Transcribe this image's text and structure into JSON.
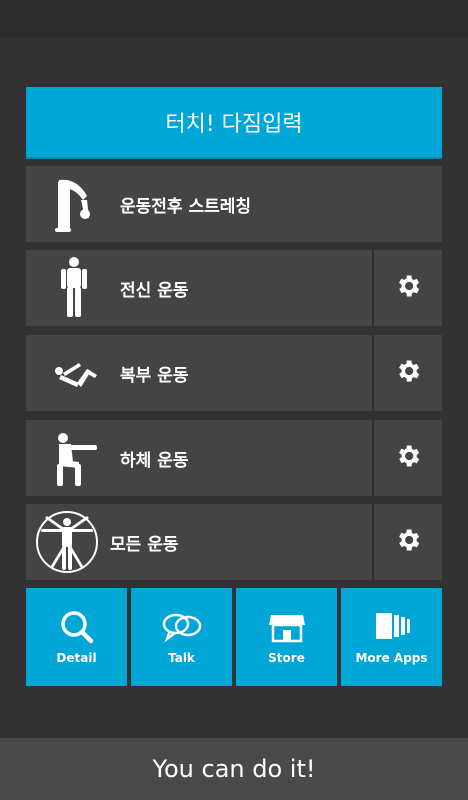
{
  "banner": {
    "label": "터치! 다짐입력"
  },
  "menu": [
    {
      "label": "운동전후 스트레칭",
      "icon": "stretching-figure-icon",
      "has_settings": false
    },
    {
      "label": "전신 운동",
      "icon": "standing-figure-icon",
      "has_settings": true
    },
    {
      "label": "복부 운동",
      "icon": "situp-figure-icon",
      "has_settings": true
    },
    {
      "label": "하체 운동",
      "icon": "squat-figure-icon",
      "has_settings": true
    },
    {
      "label": "모든 운동",
      "icon": "vitruvian-figure-icon",
      "has_settings": true
    }
  ],
  "tiles": [
    {
      "label": "Detail",
      "icon": "magnifier-icon"
    },
    {
      "label": "Talk",
      "icon": "speech-bubbles-icon"
    },
    {
      "label": "Store",
      "icon": "store-icon"
    },
    {
      "label": "More Apps",
      "icon": "stacked-cards-icon"
    }
  ],
  "footer": {
    "text": "You can do it!"
  },
  "colors": {
    "accent": "#00a6d6",
    "row_bg": "#444444",
    "page_bg": "#323232",
    "footer_bg": "#4a4a4a"
  }
}
